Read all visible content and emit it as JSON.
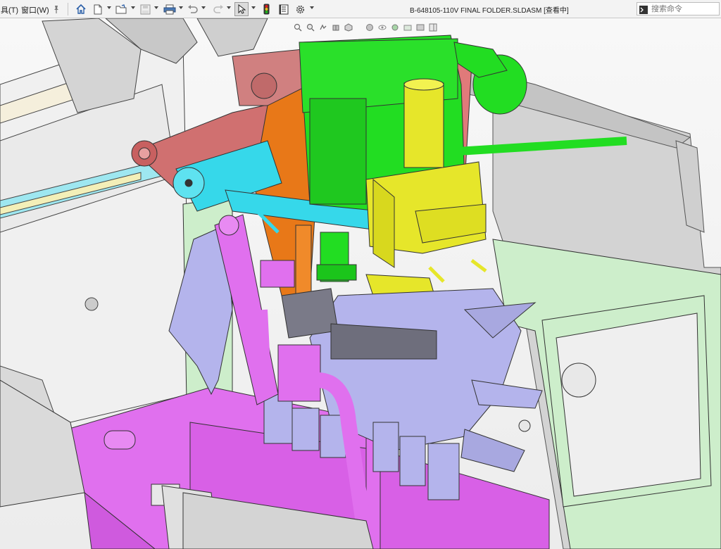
{
  "app": {
    "document_title": "B-648105-110V FINAL FOLDER.SLDASM [查看中]"
  },
  "menu": {
    "tools_label": "具(T)",
    "window_label": "窗口(W)"
  },
  "search": {
    "placeholder": "搜索命令"
  },
  "toolbar": {
    "icons": [
      "pin-icon",
      "home-icon",
      "new-document-icon",
      "open-folder-icon",
      "save-icon",
      "print-icon",
      "undo-icon",
      "redo-icon",
      "select-pointer-icon",
      "traffic-light-icon",
      "file-properties-icon",
      "options-gear-icon"
    ]
  },
  "heads_up_toolbar": {
    "icons": [
      "zoom-to-fit-icon",
      "zoom-area-icon",
      "previous-view-icon",
      "section-view-icon",
      "view-orientation-icon",
      "display-style-icon",
      "hide-show-items-icon",
      "edit-appearance-icon",
      "apply-scene-icon",
      "view-settings-icon",
      "display-pane-icon"
    ]
  },
  "colors": {
    "toolbar_bg": "#f3f3f3",
    "green_part": "#22dd22",
    "yellow_part": "#e6e62a",
    "cyan_part": "#36d8ea",
    "magenta_part": "#e070ee",
    "orange_part": "#e87818",
    "red_part": "#d07070",
    "lavender_part": "#b4b4ec",
    "frame_green": "#cdeecb",
    "frame_gray": "#d8d8d8"
  }
}
